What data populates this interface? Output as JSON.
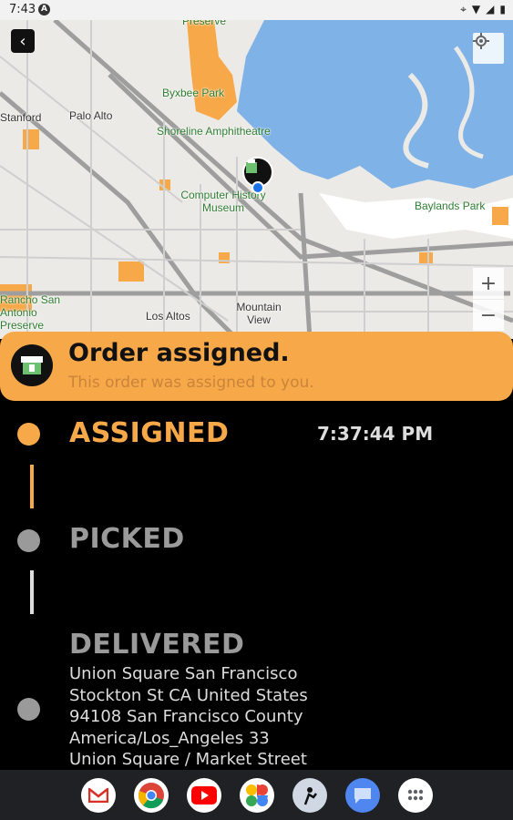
{
  "status_bar": {
    "time": "7:43",
    "badge": "A",
    "icons": [
      "location-icon",
      "wifi-icon",
      "signal-icon",
      "battery-icon"
    ]
  },
  "map": {
    "labels": [
      {
        "text": "Preserve"
      },
      {
        "text": "Byxbee Park"
      },
      {
        "text": "Palo Alto"
      },
      {
        "text": "Stanford"
      },
      {
        "text": "Shoreline Amphitheatre"
      },
      {
        "text": "Computer History Museum"
      },
      {
        "text": "Baylands Park"
      },
      {
        "text": "Los Altos"
      },
      {
        "text": "Mountain View"
      },
      {
        "text": "Rancho San Antonio Preserve"
      }
    ],
    "zoom_in_label": "+",
    "zoom_out_label": "−",
    "colors": {
      "water": "#7fb3e8",
      "land": "#eceae6",
      "parks": "#f7a94a",
      "roads": "#9e9e9e"
    }
  },
  "banner": {
    "title": "Order assigned.",
    "subtitle": "This order was assigned to you."
  },
  "timeline": {
    "steps": [
      {
        "label": "ASSIGNED",
        "time": "7:37:44 PM",
        "color": "#f7a94a",
        "active": true
      },
      {
        "label": "PICKED",
        "color": "#9a9a9a",
        "active": false
      },
      {
        "label": "DELIVERED",
        "color": "#9a9a9a",
        "active": false
      }
    ],
    "delivery_address": [
      "Union Square San Francisco",
      "Stockton St CA United States",
      "94108 San Francisco County",
      "America/Los_Angeles 33",
      "Union Square / Market Street"
    ]
  },
  "dock": {
    "apps": [
      "gmail-icon",
      "chrome-icon",
      "youtube-icon",
      "photos-icon",
      "app-icon",
      "messages-icon",
      "app-drawer-icon"
    ]
  }
}
